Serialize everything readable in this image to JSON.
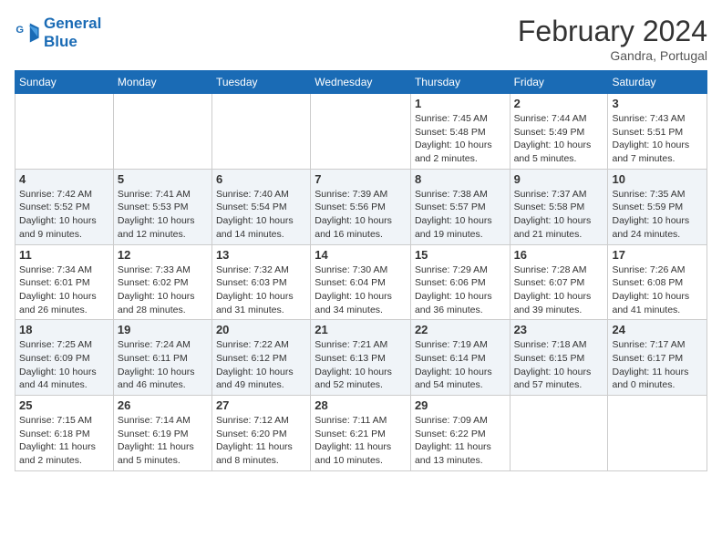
{
  "header": {
    "logo_line1": "General",
    "logo_line2": "Blue",
    "month_year": "February 2024",
    "location": "Gandra, Portugal"
  },
  "weekdays": [
    "Sunday",
    "Monday",
    "Tuesday",
    "Wednesday",
    "Thursday",
    "Friday",
    "Saturday"
  ],
  "weeks": [
    [
      {
        "day": "",
        "info": ""
      },
      {
        "day": "",
        "info": ""
      },
      {
        "day": "",
        "info": ""
      },
      {
        "day": "",
        "info": ""
      },
      {
        "day": "1",
        "info": "Sunrise: 7:45 AM\nSunset: 5:48 PM\nDaylight: 10 hours\nand 2 minutes."
      },
      {
        "day": "2",
        "info": "Sunrise: 7:44 AM\nSunset: 5:49 PM\nDaylight: 10 hours\nand 5 minutes."
      },
      {
        "day": "3",
        "info": "Sunrise: 7:43 AM\nSunset: 5:51 PM\nDaylight: 10 hours\nand 7 minutes."
      }
    ],
    [
      {
        "day": "4",
        "info": "Sunrise: 7:42 AM\nSunset: 5:52 PM\nDaylight: 10 hours\nand 9 minutes."
      },
      {
        "day": "5",
        "info": "Sunrise: 7:41 AM\nSunset: 5:53 PM\nDaylight: 10 hours\nand 12 minutes."
      },
      {
        "day": "6",
        "info": "Sunrise: 7:40 AM\nSunset: 5:54 PM\nDaylight: 10 hours\nand 14 minutes."
      },
      {
        "day": "7",
        "info": "Sunrise: 7:39 AM\nSunset: 5:56 PM\nDaylight: 10 hours\nand 16 minutes."
      },
      {
        "day": "8",
        "info": "Sunrise: 7:38 AM\nSunset: 5:57 PM\nDaylight: 10 hours\nand 19 minutes."
      },
      {
        "day": "9",
        "info": "Sunrise: 7:37 AM\nSunset: 5:58 PM\nDaylight: 10 hours\nand 21 minutes."
      },
      {
        "day": "10",
        "info": "Sunrise: 7:35 AM\nSunset: 5:59 PM\nDaylight: 10 hours\nand 24 minutes."
      }
    ],
    [
      {
        "day": "11",
        "info": "Sunrise: 7:34 AM\nSunset: 6:01 PM\nDaylight: 10 hours\nand 26 minutes."
      },
      {
        "day": "12",
        "info": "Sunrise: 7:33 AM\nSunset: 6:02 PM\nDaylight: 10 hours\nand 28 minutes."
      },
      {
        "day": "13",
        "info": "Sunrise: 7:32 AM\nSunset: 6:03 PM\nDaylight: 10 hours\nand 31 minutes."
      },
      {
        "day": "14",
        "info": "Sunrise: 7:30 AM\nSunset: 6:04 PM\nDaylight: 10 hours\nand 34 minutes."
      },
      {
        "day": "15",
        "info": "Sunrise: 7:29 AM\nSunset: 6:06 PM\nDaylight: 10 hours\nand 36 minutes."
      },
      {
        "day": "16",
        "info": "Sunrise: 7:28 AM\nSunset: 6:07 PM\nDaylight: 10 hours\nand 39 minutes."
      },
      {
        "day": "17",
        "info": "Sunrise: 7:26 AM\nSunset: 6:08 PM\nDaylight: 10 hours\nand 41 minutes."
      }
    ],
    [
      {
        "day": "18",
        "info": "Sunrise: 7:25 AM\nSunset: 6:09 PM\nDaylight: 10 hours\nand 44 minutes."
      },
      {
        "day": "19",
        "info": "Sunrise: 7:24 AM\nSunset: 6:11 PM\nDaylight: 10 hours\nand 46 minutes."
      },
      {
        "day": "20",
        "info": "Sunrise: 7:22 AM\nSunset: 6:12 PM\nDaylight: 10 hours\nand 49 minutes."
      },
      {
        "day": "21",
        "info": "Sunrise: 7:21 AM\nSunset: 6:13 PM\nDaylight: 10 hours\nand 52 minutes."
      },
      {
        "day": "22",
        "info": "Sunrise: 7:19 AM\nSunset: 6:14 PM\nDaylight: 10 hours\nand 54 minutes."
      },
      {
        "day": "23",
        "info": "Sunrise: 7:18 AM\nSunset: 6:15 PM\nDaylight: 10 hours\nand 57 minutes."
      },
      {
        "day": "24",
        "info": "Sunrise: 7:17 AM\nSunset: 6:17 PM\nDaylight: 11 hours\nand 0 minutes."
      }
    ],
    [
      {
        "day": "25",
        "info": "Sunrise: 7:15 AM\nSunset: 6:18 PM\nDaylight: 11 hours\nand 2 minutes."
      },
      {
        "day": "26",
        "info": "Sunrise: 7:14 AM\nSunset: 6:19 PM\nDaylight: 11 hours\nand 5 minutes."
      },
      {
        "day": "27",
        "info": "Sunrise: 7:12 AM\nSunset: 6:20 PM\nDaylight: 11 hours\nand 8 minutes."
      },
      {
        "day": "28",
        "info": "Sunrise: 7:11 AM\nSunset: 6:21 PM\nDaylight: 11 hours\nand 10 minutes."
      },
      {
        "day": "29",
        "info": "Sunrise: 7:09 AM\nSunset: 6:22 PM\nDaylight: 11 hours\nand 13 minutes."
      },
      {
        "day": "",
        "info": ""
      },
      {
        "day": "",
        "info": ""
      }
    ]
  ]
}
